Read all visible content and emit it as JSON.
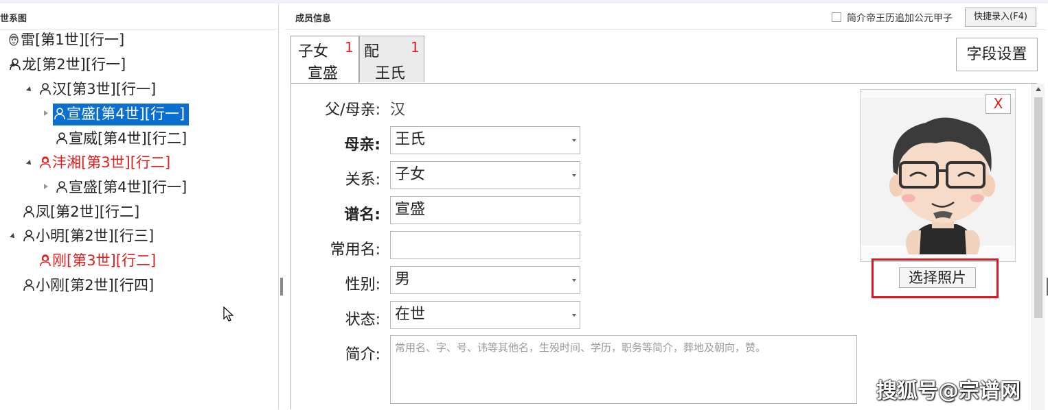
{
  "left_panel": {
    "title": "世系图",
    "tree": [
      {
        "label": "雷[第1世][行一]",
        "expander": "none",
        "icon": "portrait-icon",
        "style": "normal"
      },
      {
        "label": "龙[第2世][行一]",
        "expander": "expanded",
        "icon": "person-icon",
        "style": "normal"
      },
      {
        "label": "汉[第3世][行一]",
        "expander": "expanded",
        "icon": "person-icon",
        "style": "normal"
      },
      {
        "label": "宣盛[第4世][行一]",
        "expander": "collapsed",
        "icon": "person-icon",
        "style": "selected"
      },
      {
        "label": "宣威[第4世][行二]",
        "expander": "none",
        "icon": "person-icon",
        "style": "normal"
      },
      {
        "label": "沣湘[第3世][行二]",
        "expander": "expanded",
        "icon": "female-icon",
        "style": "red"
      },
      {
        "label": "宣盛[第4世][行一]",
        "expander": "collapsed",
        "icon": "person-icon",
        "style": "normal"
      },
      {
        "label": "凤[第2世][行二]",
        "expander": "none",
        "icon": "person-icon",
        "style": "normal"
      },
      {
        "label": "小明[第2世][行三]",
        "expander": "expanded",
        "icon": "person-icon",
        "style": "normal"
      },
      {
        "label": "刚[第3世][行二]",
        "expander": "none",
        "icon": "female-icon",
        "style": "red"
      },
      {
        "label": "小刚[第2世][行四]",
        "expander": "none",
        "icon": "person-icon",
        "style": "normal"
      }
    ]
  },
  "right_panel": {
    "title": "成员信息",
    "checkbox_label": "简介帝王历追加公元甲子",
    "checkbox_checked": false,
    "quick_entry_label": "快捷录入(F4)",
    "field_settings_label": "字段设置",
    "tabs": [
      {
        "line1": "子女",
        "count": "1",
        "line2": "宣盛",
        "active": true
      },
      {
        "line1": "配",
        "count": "1",
        "line2": "王氏",
        "active": false
      }
    ],
    "form": {
      "parent_label": "父/母亲:",
      "parent_value": "汉",
      "mother_label": "母亲:",
      "mother_value": "王氏",
      "relation_label": "关系:",
      "relation_value": "子女",
      "genealogy_name_label": "谱名:",
      "genealogy_name_value": "宣盛",
      "common_name_label": "常用名:",
      "common_name_value": "",
      "gender_label": "性别:",
      "gender_value": "男",
      "status_label": "状态:",
      "status_value": "在世",
      "bio_label": "简介:",
      "bio_placeholder": "常用名、字、号、讳等其他名，生殁时间、学历，职务等简介，葬地及朝向，赞。"
    },
    "photo": {
      "close_label": "X",
      "choose_label": "选择照片"
    }
  },
  "watermark": "搜狐号@宗谱网",
  "colors": {
    "selected_bg": "#0a6fd0",
    "red_text": "#e21b1b",
    "highlight_frame": "#e0141e"
  }
}
